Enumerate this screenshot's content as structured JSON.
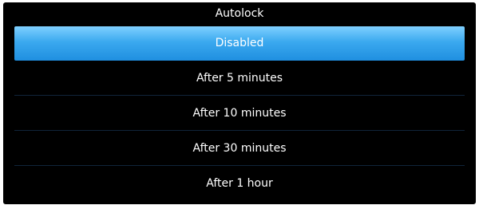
{
  "dialog": {
    "title": "Autolock",
    "options": [
      {
        "label": "Disabled",
        "selected": true
      },
      {
        "label": "After 5 minutes",
        "selected": false
      },
      {
        "label": "After 10 minutes",
        "selected": false
      },
      {
        "label": "After 30 minutes",
        "selected": false
      },
      {
        "label": "After 1 hour",
        "selected": false
      }
    ]
  },
  "colors": {
    "background": "#000000",
    "selected_highlight": "#3ba9ef",
    "divider": "#10243a",
    "text": "#ffffff"
  }
}
